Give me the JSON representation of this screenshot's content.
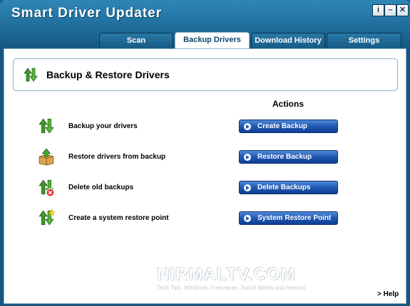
{
  "window": {
    "title": "Smart Driver Updater"
  },
  "title_controls": {
    "info": "i",
    "minimize": "–",
    "close": "✕"
  },
  "tabs": [
    {
      "label": "Scan",
      "active": false
    },
    {
      "label": "Backup Drivers",
      "active": true
    },
    {
      "label": "Download History",
      "active": false
    },
    {
      "label": "Settings",
      "active": false
    }
  ],
  "main": {
    "heading": "Backup & Restore Drivers",
    "actions_label": "Actions",
    "rows": [
      {
        "label": "Backup your drivers",
        "button": "Create Backup",
        "icon": "backup-arrows-icon"
      },
      {
        "label": "Restore drivers from backup",
        "button": "Restore Backup",
        "icon": "restore-box-icon"
      },
      {
        "label": "Delete old backups",
        "button": "Delete Backups",
        "icon": "delete-backup-icon"
      },
      {
        "label": "Create a system restore point",
        "button": "System Restore Point",
        "icon": "restore-point-icon"
      }
    ],
    "watermark": "NIRMALTV.COM",
    "watermark_sub": "Tech Tips, Windows, Freewares, Social Media and Internet",
    "help_label": "> Help"
  },
  "colors": {
    "accent": "#1f57b3",
    "title_bar": "#1e6c9a",
    "icon_green": "#3d9a2a"
  }
}
